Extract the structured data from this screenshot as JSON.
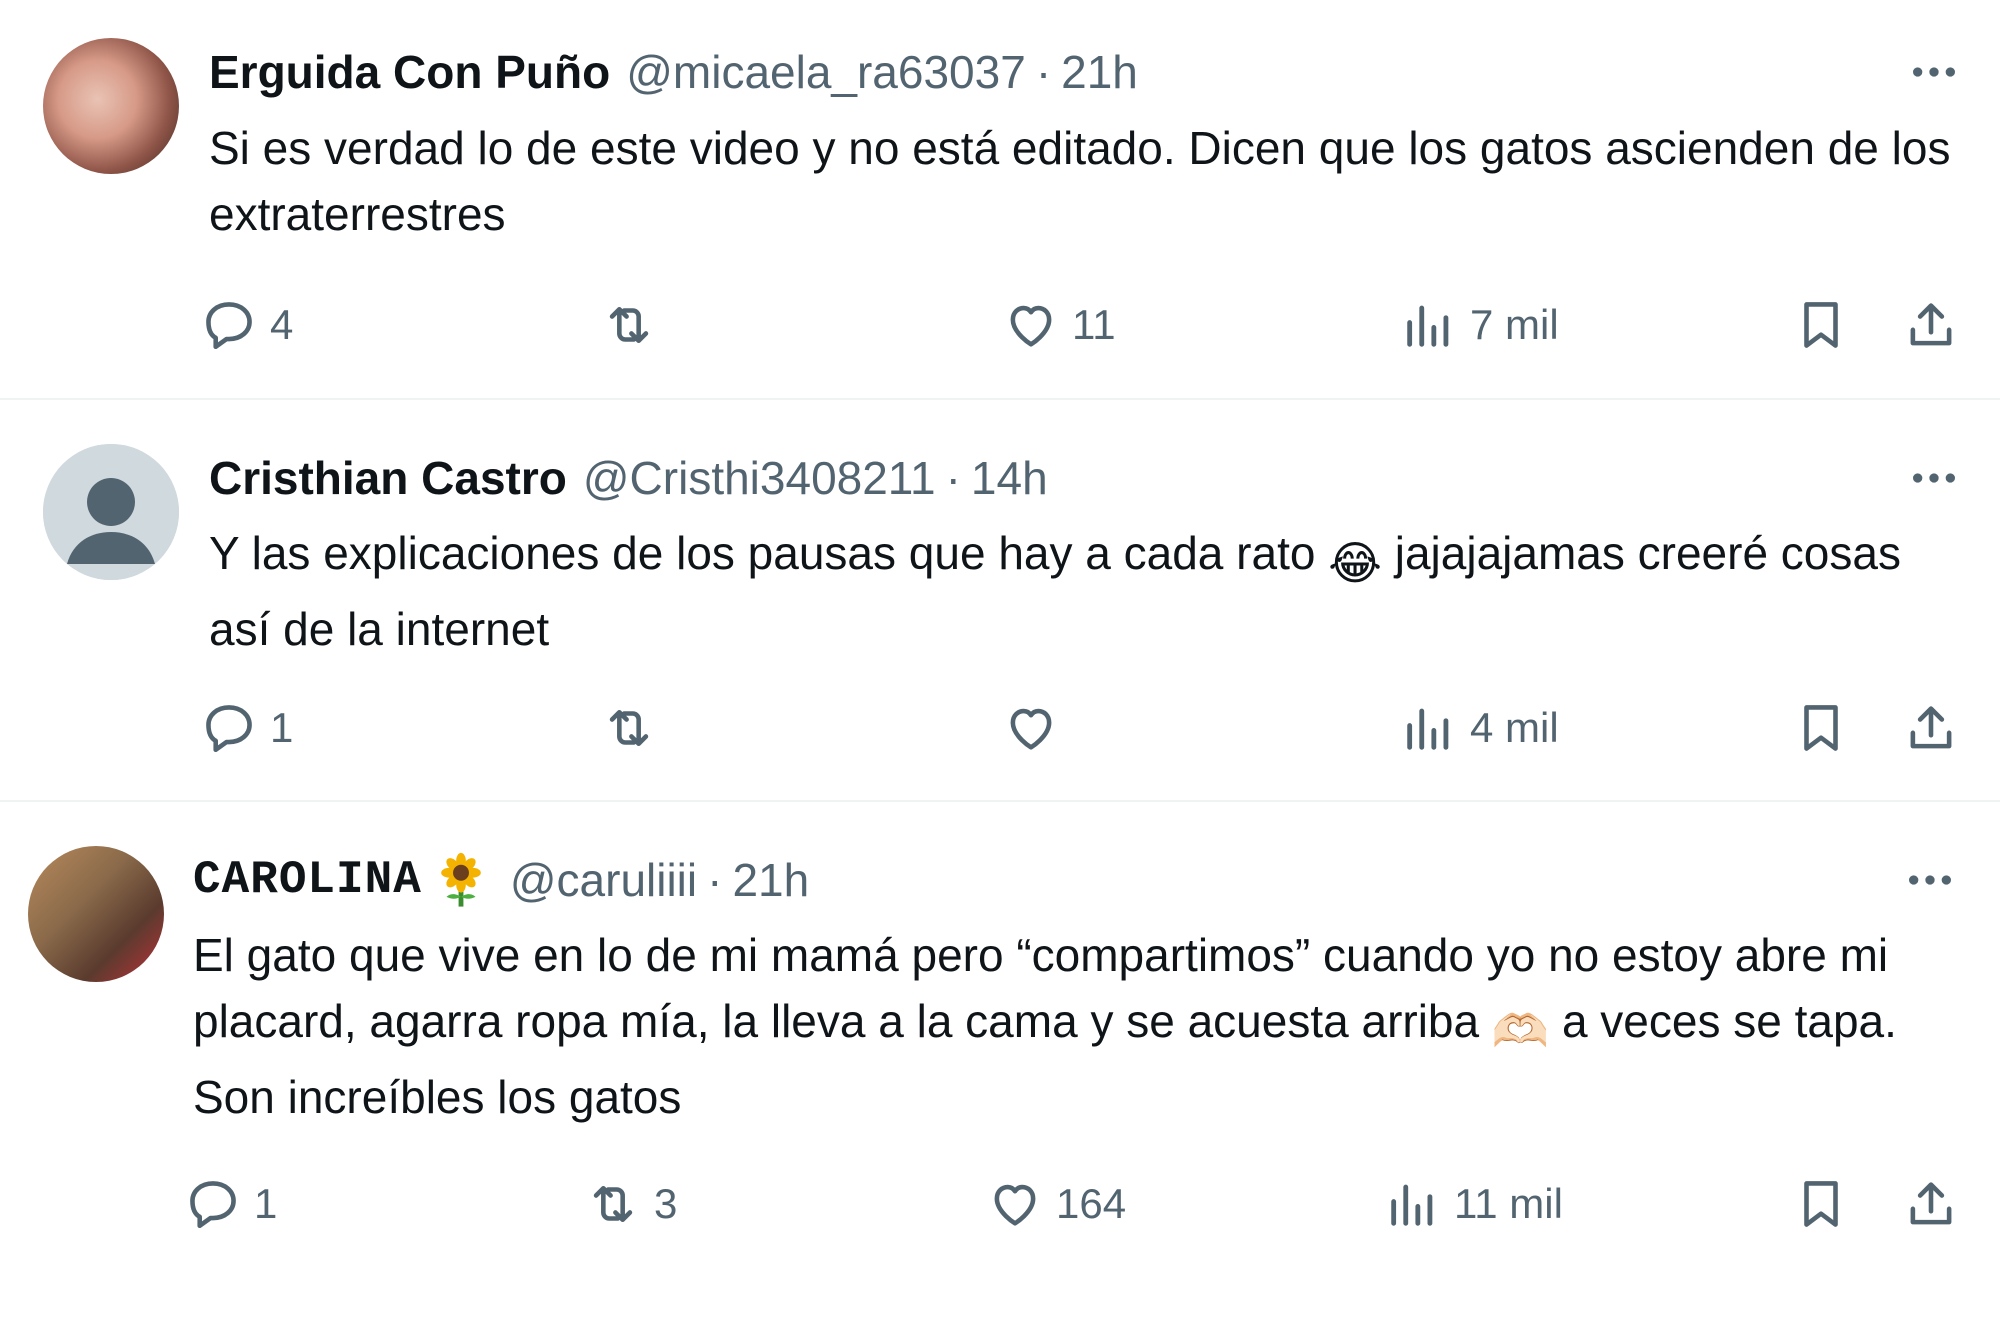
{
  "colors": {
    "text": "#0f1419",
    "muted": "#536471",
    "divider": "#eff3f4"
  },
  "replies": [
    {
      "name": "Erguida Con Puño",
      "handle": "@micaela_ra63037",
      "separator": "·",
      "time": "21h",
      "text": "Si es verdad lo de este video y no está editado. Dicen que los gatos ascienden de los extraterrestres",
      "stats": {
        "replies": "4",
        "retweets": "",
        "likes": "11",
        "views": "7 mil"
      }
    },
    {
      "name": "Cristhian Castro",
      "handle": "@Cristhi3408211",
      "separator": "·",
      "time": "14h",
      "text_before": "Y las explicaciones de los pausas que hay a cada rato",
      "emoji": "😂",
      "text_after": "jajajajamas creeré cosas así de la internet",
      "stats": {
        "replies": "1",
        "retweets": "",
        "likes": "",
        "views": "4 mil"
      }
    },
    {
      "name": "CAROLINA",
      "name_emoji": "sunflower-emoji",
      "handle": "@caruliiii",
      "separator": "·",
      "time": "21h",
      "text_before": "El gato que vive en lo de mi mamá pero “compartimos” cuando yo no estoy abre mi placard, agarra ropa mía, la lleva a la cama y se acuesta arriba",
      "emoji": "🫶🏻",
      "text_after": "a veces se tapa. Son increíbles los gatos",
      "stats": {
        "replies": "1",
        "retweets": "3",
        "likes": "164",
        "views": "11 mil"
      }
    }
  ],
  "icons": {
    "reply": "reply-icon",
    "retweet": "retweet-icon",
    "like": "heart-icon",
    "views": "views-icon",
    "bookmark": "bookmark-icon",
    "share": "share-icon",
    "more": "more-icon"
  }
}
